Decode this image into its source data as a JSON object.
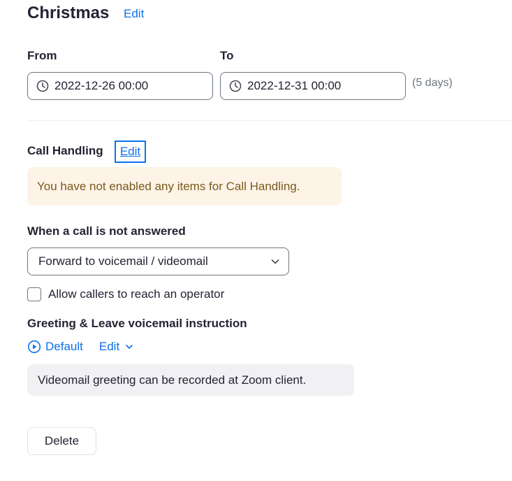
{
  "header": {
    "title": "Christmas",
    "edit_label": "Edit"
  },
  "dates": {
    "from_label": "From",
    "to_label": "To",
    "from_value": "2022-12-26 00:00",
    "to_value": "2022-12-31 00:00",
    "duration": "(5 days)"
  },
  "call_handling": {
    "label": "Call Handling",
    "edit_label": "Edit",
    "notice": "You have not enabled any items for Call Handling."
  },
  "not_answered": {
    "label": "When a call is not answered",
    "selected": "Forward to voicemail / videomail",
    "operator_checkbox_label": "Allow callers to reach an operator",
    "operator_checked": false
  },
  "greeting": {
    "label": "Greeting & Leave voicemail instruction",
    "default_label": "Default",
    "edit_label": "Edit",
    "info": "Videomail greeting can be recorded at Zoom client."
  },
  "actions": {
    "delete_label": "Delete"
  },
  "colors": {
    "accent": "#0e71eb",
    "text": "#232333",
    "warning_bg": "#fdf3e7",
    "info_bg": "#f1f1f4"
  },
  "icons": [
    "clock-icon",
    "chevron-down-icon",
    "play-circle-icon"
  ]
}
